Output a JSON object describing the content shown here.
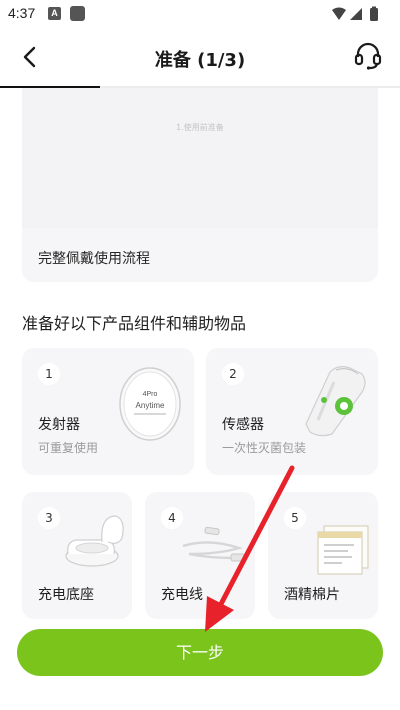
{
  "status_bar": {
    "time": "4:37",
    "notification_letter": "A"
  },
  "header": {
    "title": "准备 (1/3)",
    "progress": 0.25
  },
  "video": {
    "caption": "1.使用前准备",
    "label": "完整佩戴使用流程"
  },
  "section_title": "准备好以下产品组件和辅助物品",
  "items": [
    {
      "num": "1",
      "name": "发射器",
      "sub": "可重复使用",
      "img_text_top": "4Pro",
      "img_text": "Anytime"
    },
    {
      "num": "2",
      "name": "传感器",
      "sub": "一次性灭菌包装"
    },
    {
      "num": "3",
      "name": "充电底座"
    },
    {
      "num": "4",
      "name": "充电线"
    },
    {
      "num": "5",
      "name": "酒精棉片"
    }
  ],
  "next_button": {
    "label": "下一步"
  },
  "colors": {
    "accent": "#7ac41c",
    "annotation_arrow": "#e8222a"
  }
}
